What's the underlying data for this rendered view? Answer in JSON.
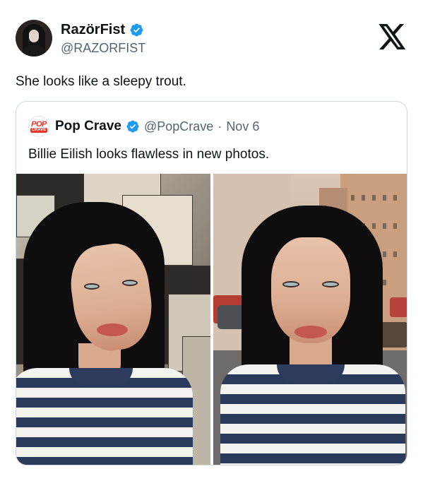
{
  "tweet": {
    "author_name": "RazörFist",
    "author_handle": "@RAZORFIST",
    "text": "She looks like a sleepy trout."
  },
  "quoted_tweet": {
    "author_name": "Pop Crave",
    "author_handle": "@PopCrave",
    "separator": "·",
    "date": "Nov 6",
    "text": "Billie Eilish looks flawless in new photos.",
    "avatar_logo_top": "POP",
    "avatar_logo_bottom": "CRAVE",
    "photos": [
      "selfie-against-poster-wall",
      "portrait-in-city-street"
    ]
  },
  "icons": {
    "verified": "verified-badge-icon",
    "brand": "x-logo-icon"
  },
  "colors": {
    "verified_blue": "#1d9bf0",
    "handle_gray": "#536471",
    "border": "#cfd9de"
  }
}
